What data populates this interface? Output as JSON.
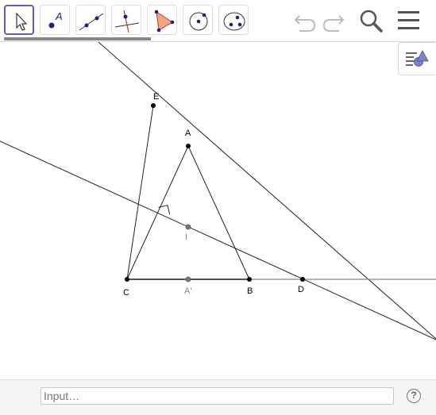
{
  "toolbar": {
    "tools": [
      {
        "name": "move-tool",
        "icon": "arrow-cursor-icon",
        "selected": true
      },
      {
        "name": "point-tool",
        "icon": "point-icon",
        "label": "A"
      },
      {
        "name": "line-tool",
        "icon": "line-icon"
      },
      {
        "name": "perpendicular-line-tool",
        "icon": "perpendicular-line-icon"
      },
      {
        "name": "polygon-tool",
        "icon": "polygon-icon"
      },
      {
        "name": "circle-tool",
        "icon": "circle-center-point-icon"
      },
      {
        "name": "conic-tool",
        "icon": "ellipse-icon"
      }
    ],
    "undo_icon": "undo-icon",
    "redo_icon": "redo-icon",
    "search_icon": "search-icon",
    "menu_icon": "hamburger-menu-icon"
  },
  "stylebar": {
    "icon": "style-bar-toggle-icon"
  },
  "canvas": {
    "points": {
      "E": {
        "label": "E"
      },
      "A": {
        "label": "A"
      },
      "I": {
        "label": "I"
      },
      "C": {
        "label": "C"
      },
      "A_prime": {
        "label": "A'"
      },
      "B": {
        "label": "B"
      },
      "D": {
        "label": "D"
      }
    }
  },
  "input_bar": {
    "placeholder": "Input…",
    "help_label": "?"
  },
  "colors": {
    "accent": "#6557d2",
    "point": "#000000",
    "aux_point": "#666666",
    "tool_point": "#1a237e",
    "polygon_fill": "#f4a582",
    "perp_red": "#c0392b"
  }
}
